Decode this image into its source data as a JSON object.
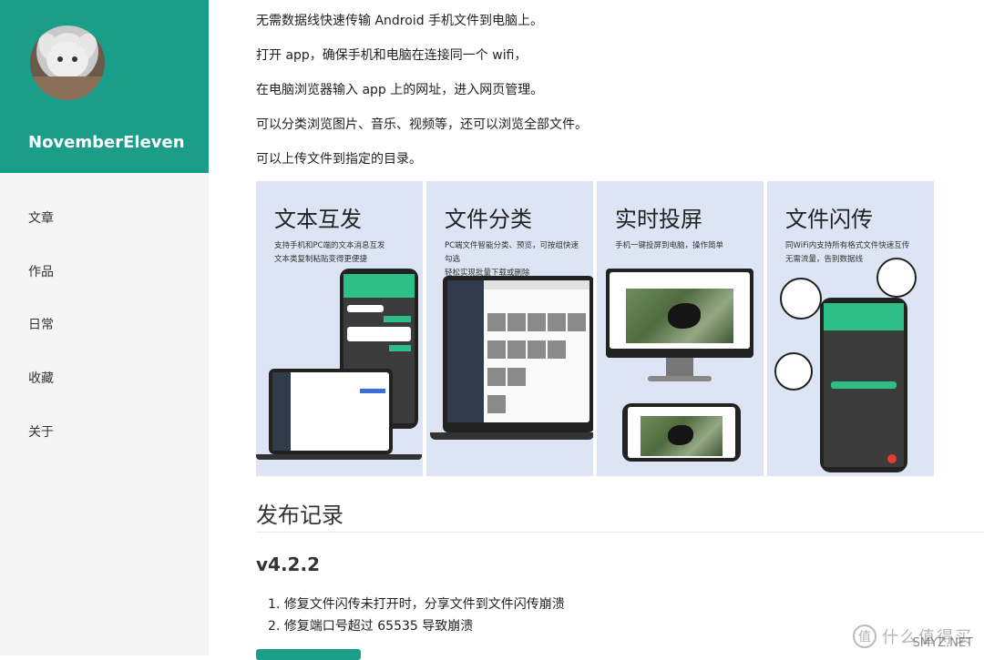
{
  "sidebar": {
    "username": "NovemberEleven",
    "nav": [
      "文章",
      "作品",
      "日常",
      "收藏",
      "关于"
    ]
  },
  "intro": [
    "无需数据线快速传输 Android 手机文件到电脑上。",
    "打开 app，确保手机和电脑在连接同一个 wifi，",
    "在电脑浏览器输入 app 上的网址，进入网页管理。",
    "可以分类浏览图片、音乐、视频等，还可以浏览全部文件。",
    "可以上传文件到指定的目录。"
  ],
  "promo": [
    {
      "title": "文本互发",
      "desc1": "支持手机和PC端的文本消息互发",
      "desc2": "文本类复制粘贴变得更便捷"
    },
    {
      "title": "文件分类",
      "desc1": "PC端文件智能分类、预览，可按组快速勾选",
      "desc2": "轻松实现批量下载或删除"
    },
    {
      "title": "实时投屏",
      "desc1": "手机一键投屏到电脑，操作简单",
      "desc2": ""
    },
    {
      "title": "文件闪传",
      "desc1": "同WiFi内支持所有格式文件快速互传",
      "desc2": "无需流量，告别数据线"
    }
  ],
  "release": {
    "heading": "发布记录",
    "version": "v4.2.2",
    "changes": [
      "1. 修复文件闪传未打开时，分享文件到文件闪传崩溃",
      "2. 修复端口号超过 65535 导致崩溃"
    ]
  },
  "watermark": {
    "text": "什么值得买",
    "site": "SMYZ.NET"
  },
  "colors": {
    "brand": "#1a9e8a",
    "card_bg": "#dde4f3",
    "accent_green": "#2ebf88"
  }
}
